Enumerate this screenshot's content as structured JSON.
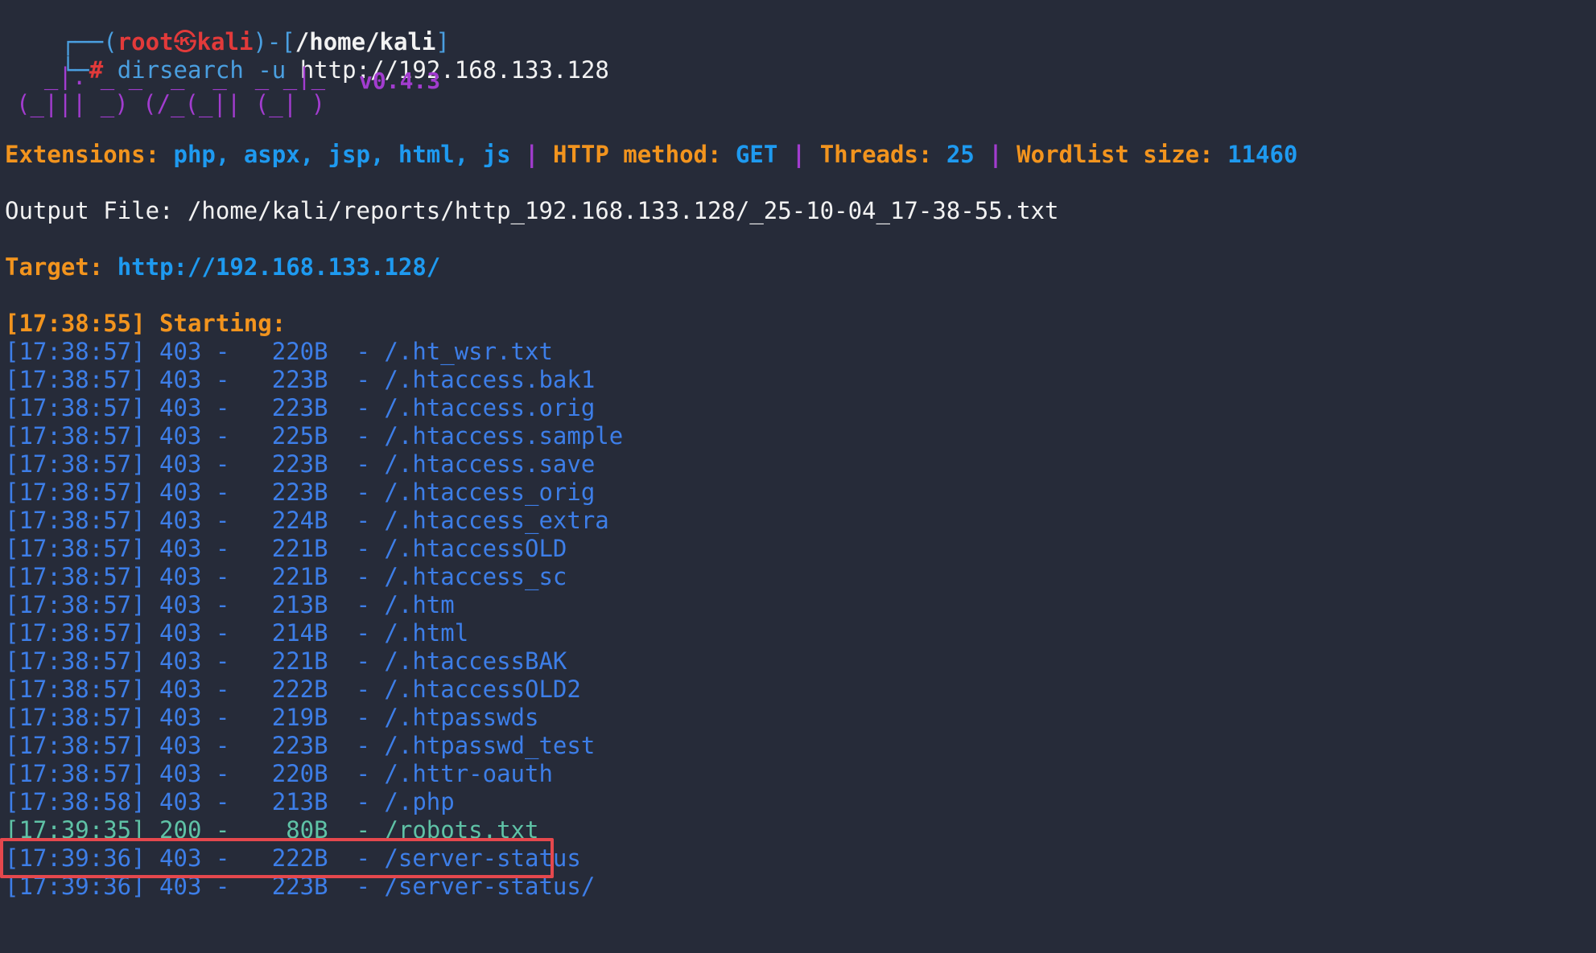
{
  "prompt": {
    "corner_top": "┌──",
    "open_paren": "(",
    "user": "root",
    "at_symbol": "㉿",
    "host": "kali",
    "close_paren": ")-[",
    "cwd": "/home/kali",
    "close_bracket": "]",
    "corner_bottom": "└─",
    "hash": "#",
    "command": "dirsearch",
    "flag": "-u",
    "url": "http://192.168.133.128"
  },
  "banner": {
    "art_line1": "  _|. _ _  _  _  _ _|_    ",
    "art_line2": "(_||| _) (/_(_|| (_| )",
    "version": "v0.4.3"
  },
  "config": {
    "ext_label": "Extensions: ",
    "ext_value": "php, aspx, jsp, html, js",
    "sep1": " | ",
    "method_label": "HTTP method: ",
    "method_value": "GET",
    "sep2": " | ",
    "threads_label": "Threads: ",
    "threads_value": "25",
    "sep3": " | ",
    "wordlist_label": "Wordlist size: ",
    "wordlist_value": "11460"
  },
  "output_file": "Output File: /home/kali/reports/http_192.168.133.128/_25-10-04_17-38-55.txt",
  "target": {
    "label": "Target: ",
    "url": "http://192.168.133.128/"
  },
  "starting": "[17:38:55] Starting: ",
  "results": [
    {
      "text": "[17:38:57] 403 -   220B  - /.ht_wsr.txt",
      "status": "403"
    },
    {
      "text": "[17:38:57] 403 -   223B  - /.htaccess.bak1",
      "status": "403"
    },
    {
      "text": "[17:38:57] 403 -   223B  - /.htaccess.orig",
      "status": "403"
    },
    {
      "text": "[17:38:57] 403 -   225B  - /.htaccess.sample",
      "status": "403"
    },
    {
      "text": "[17:38:57] 403 -   223B  - /.htaccess.save",
      "status": "403"
    },
    {
      "text": "[17:38:57] 403 -   223B  - /.htaccess_orig",
      "status": "403"
    },
    {
      "text": "[17:38:57] 403 -   224B  - /.htaccess_extra",
      "status": "403"
    },
    {
      "text": "[17:38:57] 403 -   221B  - /.htaccessOLD",
      "status": "403"
    },
    {
      "text": "[17:38:57] 403 -   221B  - /.htaccess_sc",
      "status": "403"
    },
    {
      "text": "[17:38:57] 403 -   213B  - /.htm",
      "status": "403"
    },
    {
      "text": "[17:38:57] 403 -   214B  - /.html",
      "status": "403"
    },
    {
      "text": "[17:38:57] 403 -   221B  - /.htaccessBAK",
      "status": "403"
    },
    {
      "text": "[17:38:57] 403 -   222B  - /.htaccessOLD2",
      "status": "403"
    },
    {
      "text": "[17:38:57] 403 -   219B  - /.htpasswds",
      "status": "403"
    },
    {
      "text": "[17:38:57] 403 -   223B  - /.htpasswd_test",
      "status": "403"
    },
    {
      "text": "[17:38:57] 403 -   220B  - /.httr-oauth",
      "status": "403"
    },
    {
      "text": "[17:38:58] 403 -   213B  - /.php",
      "status": "403"
    },
    {
      "text": "[17:39:35] 200 -    80B  - /robots.txt",
      "status": "200"
    },
    {
      "text": "[17:39:36] 403 -   222B  - /server-status",
      "status": "403"
    },
    {
      "text": "[17:39:36] 403 -   223B  - /server-status/",
      "status": "403"
    }
  ],
  "colors": {
    "background": "#262b39",
    "status_403": "#3d7ee8",
    "status_200": "#5fc2a6",
    "highlight_border": "#e5484d"
  }
}
